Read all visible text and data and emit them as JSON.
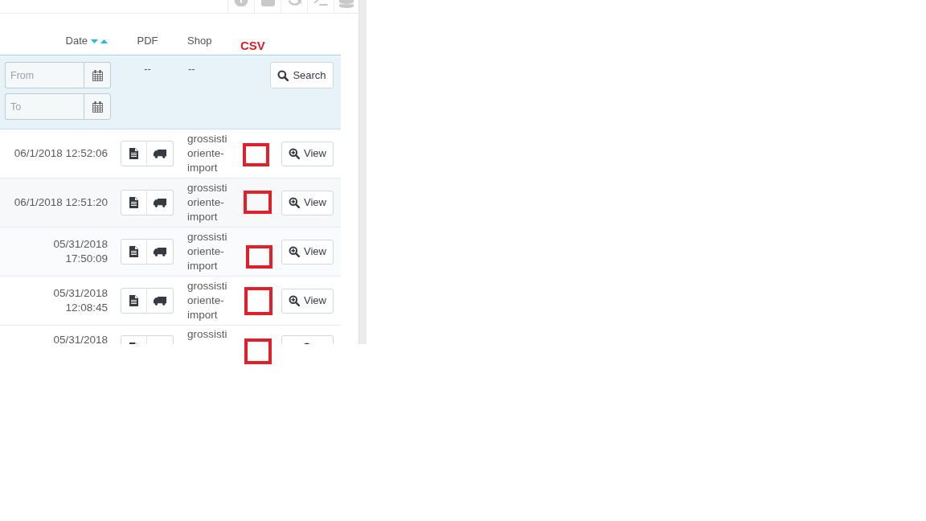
{
  "table": {
    "columns": [
      {
        "label": "Date",
        "sortable": true
      },
      {
        "label": "PDF",
        "sortable": false
      },
      {
        "label": "Shop",
        "sortable": false
      }
    ],
    "annotation_label": "CSV",
    "filters": {
      "date_from": {
        "placeholder": "From"
      },
      "date_to": {
        "placeholder": "To"
      },
      "pdf": "--",
      "shop": "--",
      "search_button": "Search"
    },
    "rows": [
      {
        "date": "06/1/2018 12:52:06",
        "shop": "grossisti oriente-import",
        "view_button": "View"
      },
      {
        "date": "06/1/2018 12:51:20",
        "shop": "grossisti oriente-import",
        "view_button": "View"
      },
      {
        "date": "05/31/2018 17:50:09",
        "shop": "grossisti oriente-import",
        "view_button": "View"
      },
      {
        "date": "05/31/2018 12:08:45",
        "shop": "grossisti oriente-import",
        "view_button": "View"
      },
      {
        "date": "05/31/2018",
        "shop": "grossisti"
      }
    ]
  }
}
